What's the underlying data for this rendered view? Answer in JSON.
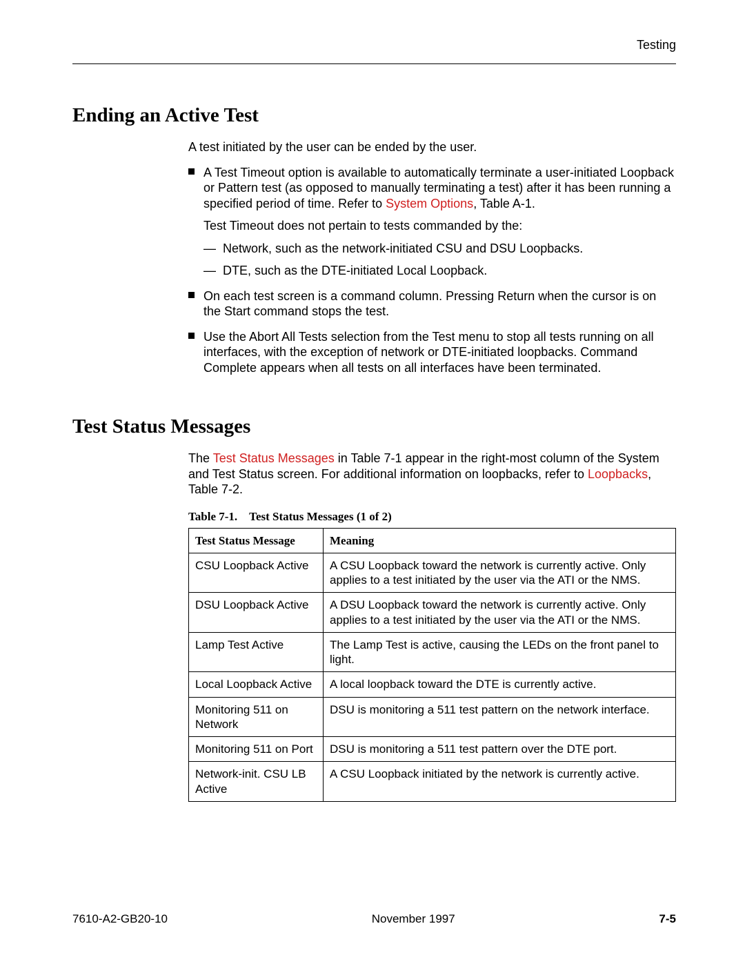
{
  "header": {
    "section_label": "Testing"
  },
  "section1": {
    "title": "Ending an Active Test",
    "intro": "A test initiated by the user can be ended by the user.",
    "b1_pre": "A Test Timeout option is available to automatically terminate a user-initiated Loopback or Pattern test (as opposed to manually terminating a test) after it has been running a specified period of time. Refer to ",
    "b1_link": "System Options",
    "b1_post": ", Table A-1.",
    "b1_sub": "Test Timeout does not pertain to tests commanded by the:",
    "b1_d1": "Network, such as the network-initiated CSU and DSU Loopbacks.",
    "b1_d2": "DTE, such as the DTE-initiated Local Loopback.",
    "b2": "On each test screen is a command column. Pressing Return when the cursor is on the Start command stops the test.",
    "b3": "Use the Abort All Tests selection from the Test menu to stop all tests running on all interfaces, with the exception of network or DTE-initiated loopbacks. Command Complete appears when all tests on all interfaces have been terminated."
  },
  "section2": {
    "title": "Test Status Messages",
    "p_pre": "The ",
    "p_link1": "Test Status Messages",
    "p_mid": " in Table 7-1 appear in the right-most column of the System and Test Status screen. For additional information on loopbacks, refer to ",
    "p_link2": "Loopbacks",
    "p_post": ", Table 7-2.",
    "caption": "Table 7-1. Test Status Messages (1 of 2)",
    "col1": "Test Status Message",
    "col2": "Meaning",
    "rows": [
      {
        "msg": "CSU Loopback Active",
        "meaning": "A CSU Loopback toward the network is currently active. Only applies to a test initiated by the user via the ATI or the NMS."
      },
      {
        "msg": "DSU Loopback Active",
        "meaning": "A DSU Loopback toward the network is currently active. Only applies to a test initiated by the user via the ATI or the NMS."
      },
      {
        "msg": "Lamp Test Active",
        "meaning": "The Lamp Test is active, causing the LEDs on the front panel to light."
      },
      {
        "msg": "Local Loopback Active",
        "meaning": "A local loopback toward the DTE is currently active."
      },
      {
        "msg": "Monitoring 511 on Network",
        "meaning": "DSU is monitoring a 511 test pattern on the network interface."
      },
      {
        "msg": "Monitoring 511 on Port",
        "meaning": "DSU is monitoring a 511 test pattern over the DTE port."
      },
      {
        "msg": "Network-init. CSU LB Active",
        "meaning": "A CSU Loopback initiated by the network is currently active."
      }
    ]
  },
  "footer": {
    "doc_id": "7610-A2-GB20-10",
    "date": "November 1997",
    "page": "7-5"
  }
}
